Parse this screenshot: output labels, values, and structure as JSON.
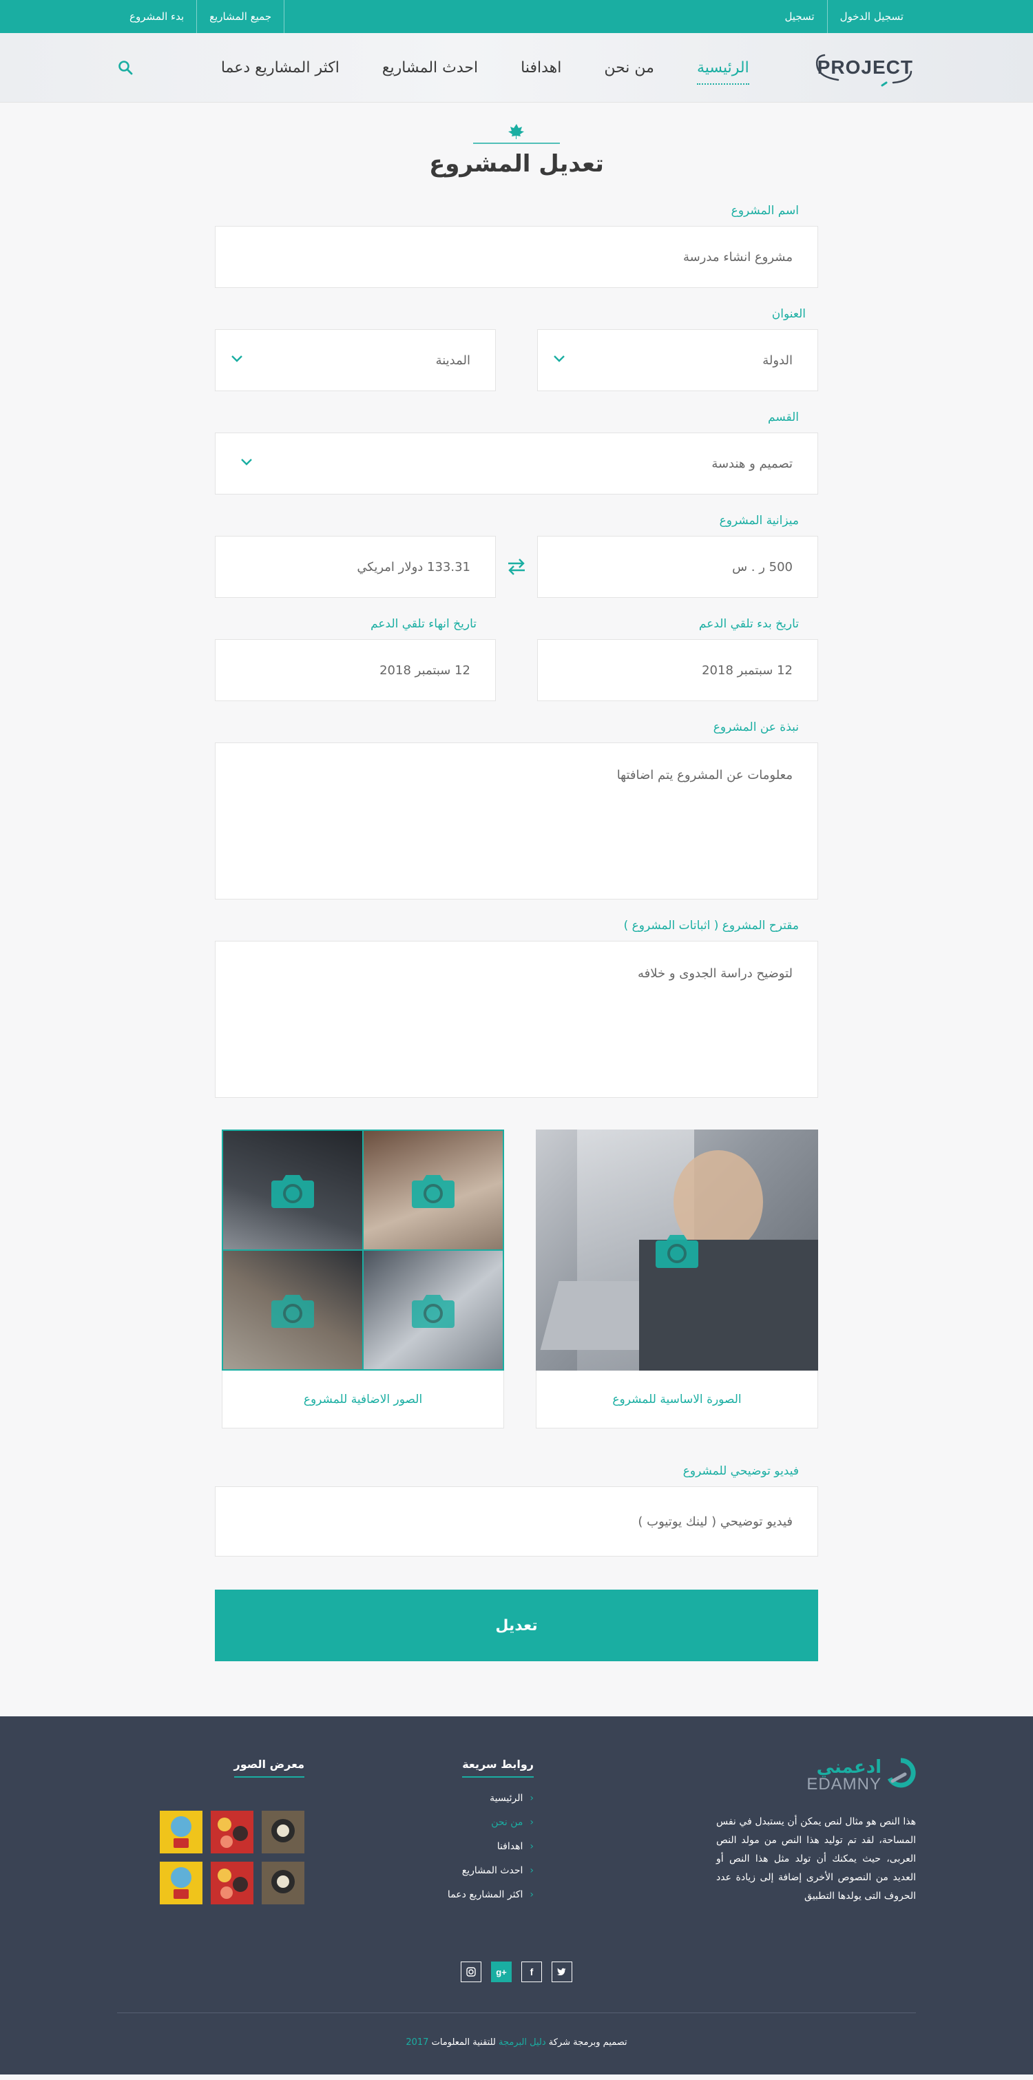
{
  "topbar": {
    "login": "تسجيل الدخول",
    "register": "تسجيل",
    "all_projects": "جميع المشاريع",
    "start_project": "بدء المشروع"
  },
  "header": {
    "logo_text": "PROJECT",
    "nav": [
      "الرئيسية",
      "من نحن",
      "اهدافنا",
      "احدث المشاريع",
      "اكثر المشاريع دعما"
    ]
  },
  "page": {
    "title": "تعديل المشروع"
  },
  "form": {
    "project_name": {
      "label": "اسم المشروع",
      "value": "مشروع انشاء مدرسة"
    },
    "address": {
      "label": "العنوان",
      "country": "الدولة",
      "city": "المدينة"
    },
    "category": {
      "label": "القسم",
      "value": "تصميم و هندسة"
    },
    "budget": {
      "label": "ميزانية المشروع",
      "value_sar": "500 ر . س",
      "value_usd": "133.31 دولار امريكي"
    },
    "start_date": {
      "label": "تاريخ بدء تلقي الدعم",
      "value": "12 سبتمبر 2018"
    },
    "end_date": {
      "label": "تاريخ انهاء تلقي الدعم",
      "value": "12 سبتمبر 2018"
    },
    "about": {
      "label": "نبذة عن المشروع",
      "value": "معلومات عن المشروع يتم اضافتها"
    },
    "proposal": {
      "label": "مقترح المشروع ( اثباتات المشروع )",
      "value": "لتوضيح دراسة الجدوى و خلافه"
    },
    "main_image": {
      "caption": "الصورة الاساسية للمشروع"
    },
    "extra_images": {
      "caption": "الصور الاضافية للمشروع"
    },
    "video": {
      "label": "فيديو توضيحي للمشروع",
      "placeholder": "فيديو توضيحي ( لينك يوتيوب )"
    },
    "submit_label": "تعديل"
  },
  "footer": {
    "logo_ar": "ادعمني",
    "logo_en": "EDAMNY",
    "about_text": "هذا النص هو مثال لنص يمكن أن يستبدل في نفس المساحة، لقد تم توليد هذا النص من مولد النص العربى، حيث يمكنك أن تولد مثل هذا النص أو العديد من النصوص الأخرى إضافة إلى زيادة عدد الحروف التى يولدها التطبيق",
    "quick_links_title": "روابط سريعة",
    "quick_links": [
      "الرئيسية",
      "من نحن",
      "اهدافنا",
      "احدث المشاريع",
      "اكثر المشاريع دعما"
    ],
    "gallery_title": "معرض الصور",
    "copyright_pre": "تصميم وبرمجة شركة",
    "copyright_company": "دليل البرمجة",
    "copyright_post": "للتقنية المعلومات",
    "copyright_year": "2017"
  },
  "colors": {
    "accent": "#1aaea2",
    "footer_bg": "#3a4354"
  }
}
